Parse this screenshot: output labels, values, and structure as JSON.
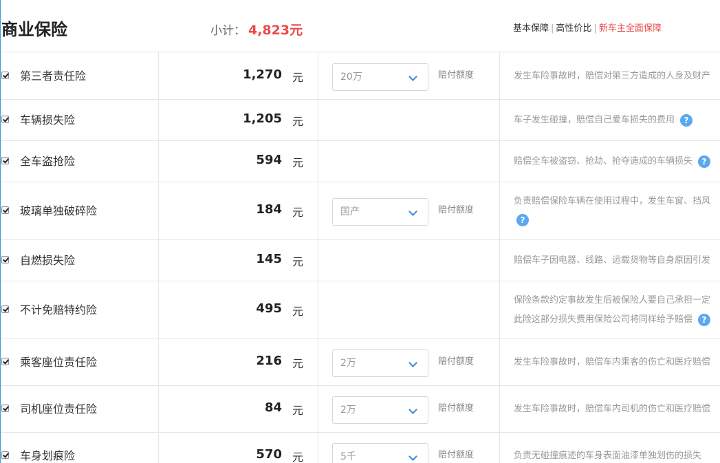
{
  "header": {
    "title": "商业保险",
    "subtotal_label": "小计：",
    "subtotal_value": "4,823元",
    "plans": [
      {
        "label": "基本保障",
        "active": false
      },
      {
        "label": "高性价比",
        "active": false
      },
      {
        "label": "新车主全面保障",
        "active": true
      }
    ]
  },
  "unit": "元",
  "select_label": "赔付额度",
  "help_glyph": "?",
  "rows": [
    {
      "name": "第三者责任险",
      "price": "1,270",
      "checked": true,
      "select": "20万",
      "desc": [
        "发生车险事故时，赔偿对第三方造成的人身及财产"
      ]
    },
    {
      "name": "车辆损失险",
      "price": "1,205",
      "checked": true,
      "select": null,
      "desc": [
        "车子发生碰撞，赔偿自己爱车损失的费用"
      ]
    },
    {
      "name": "全车盗抢险",
      "price": "594",
      "checked": true,
      "select": null,
      "desc": [
        "赔偿全车被盗窃、抢劫、抢夺造成的车辆损失"
      ]
    },
    {
      "name": "玻璃单独破碎险",
      "price": "184",
      "checked": true,
      "select": "国产",
      "desc": [
        "负责赔偿保险车辆在使用过程中，发生车窗、挡风"
      ]
    },
    {
      "name": "自燃损失险",
      "price": "145",
      "checked": true,
      "select": null,
      "desc": [
        "赔偿车子因电器、线路、运载货物等自身原因引发"
      ]
    },
    {
      "name": "不计免赔特约险",
      "price": "495",
      "checked": true,
      "select": null,
      "desc": [
        "保险条款约定事故发生后被保险人要自己承担一定",
        "此险这部分损失费用保险公司将同样给予赔偿"
      ]
    },
    {
      "name": "乘客座位责任险",
      "price": "216",
      "checked": true,
      "select": "2万",
      "desc": [
        "发生车险事故时，赔偿车内乘客的伤亡和医疗赔偿"
      ]
    },
    {
      "name": "司机座位责任险",
      "price": "84",
      "checked": true,
      "select": "2万",
      "desc": [
        "发生车险事故时，赔偿车内司机的伤亡和医疗赔偿"
      ]
    },
    {
      "name": "车身划痕险",
      "price": "570",
      "checked": true,
      "select": "5千",
      "desc": [
        "负责无碰撞痕迹的车身表面油漆单独划伤的损失"
      ]
    }
  ],
  "colors": {
    "accent_red": "#e94b4b",
    "help_blue": "#5aa8f0",
    "chevron_blue": "#3a87d3"
  }
}
